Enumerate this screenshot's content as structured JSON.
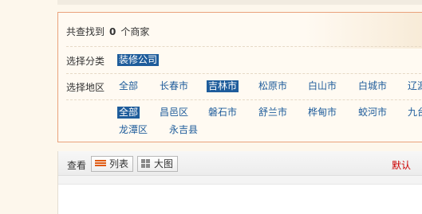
{
  "result": {
    "prefix": "共查找到",
    "count": "0",
    "suffix": "个商家"
  },
  "category": {
    "label": "选择分类",
    "options": [
      {
        "label": "装修公司",
        "selected": true
      }
    ]
  },
  "region": {
    "label": "选择地区",
    "cities": [
      {
        "label": "全部",
        "selected": false
      },
      {
        "label": "长春市",
        "selected": false
      },
      {
        "label": "吉林市",
        "selected": true
      },
      {
        "label": "松原市",
        "selected": false
      },
      {
        "label": "白山市",
        "selected": false
      },
      {
        "label": "白城市",
        "selected": false
      },
      {
        "label": "辽源",
        "selected": false
      }
    ],
    "districts": [
      {
        "label": "全部",
        "selected": true
      },
      {
        "label": "昌邑区",
        "selected": false
      },
      {
        "label": "磐石市",
        "selected": false
      },
      {
        "label": "舒兰市",
        "selected": false
      },
      {
        "label": "桦甸市",
        "selected": false
      },
      {
        "label": "蛟河市",
        "selected": false
      },
      {
        "label": "九台",
        "selected": false
      },
      {
        "label": "龙潭区",
        "selected": false
      },
      {
        "label": "永吉县",
        "selected": false
      }
    ]
  },
  "view": {
    "label": "查看",
    "list_button": "列表",
    "grid_button": "大图",
    "sort_default": "默认"
  },
  "colors": {
    "link": "#1e5c9b",
    "selected_bg": "#1e5c9b",
    "box_border": "#e9a27c",
    "accent_red": "#cc0000",
    "list_icon": "#e05a12"
  }
}
